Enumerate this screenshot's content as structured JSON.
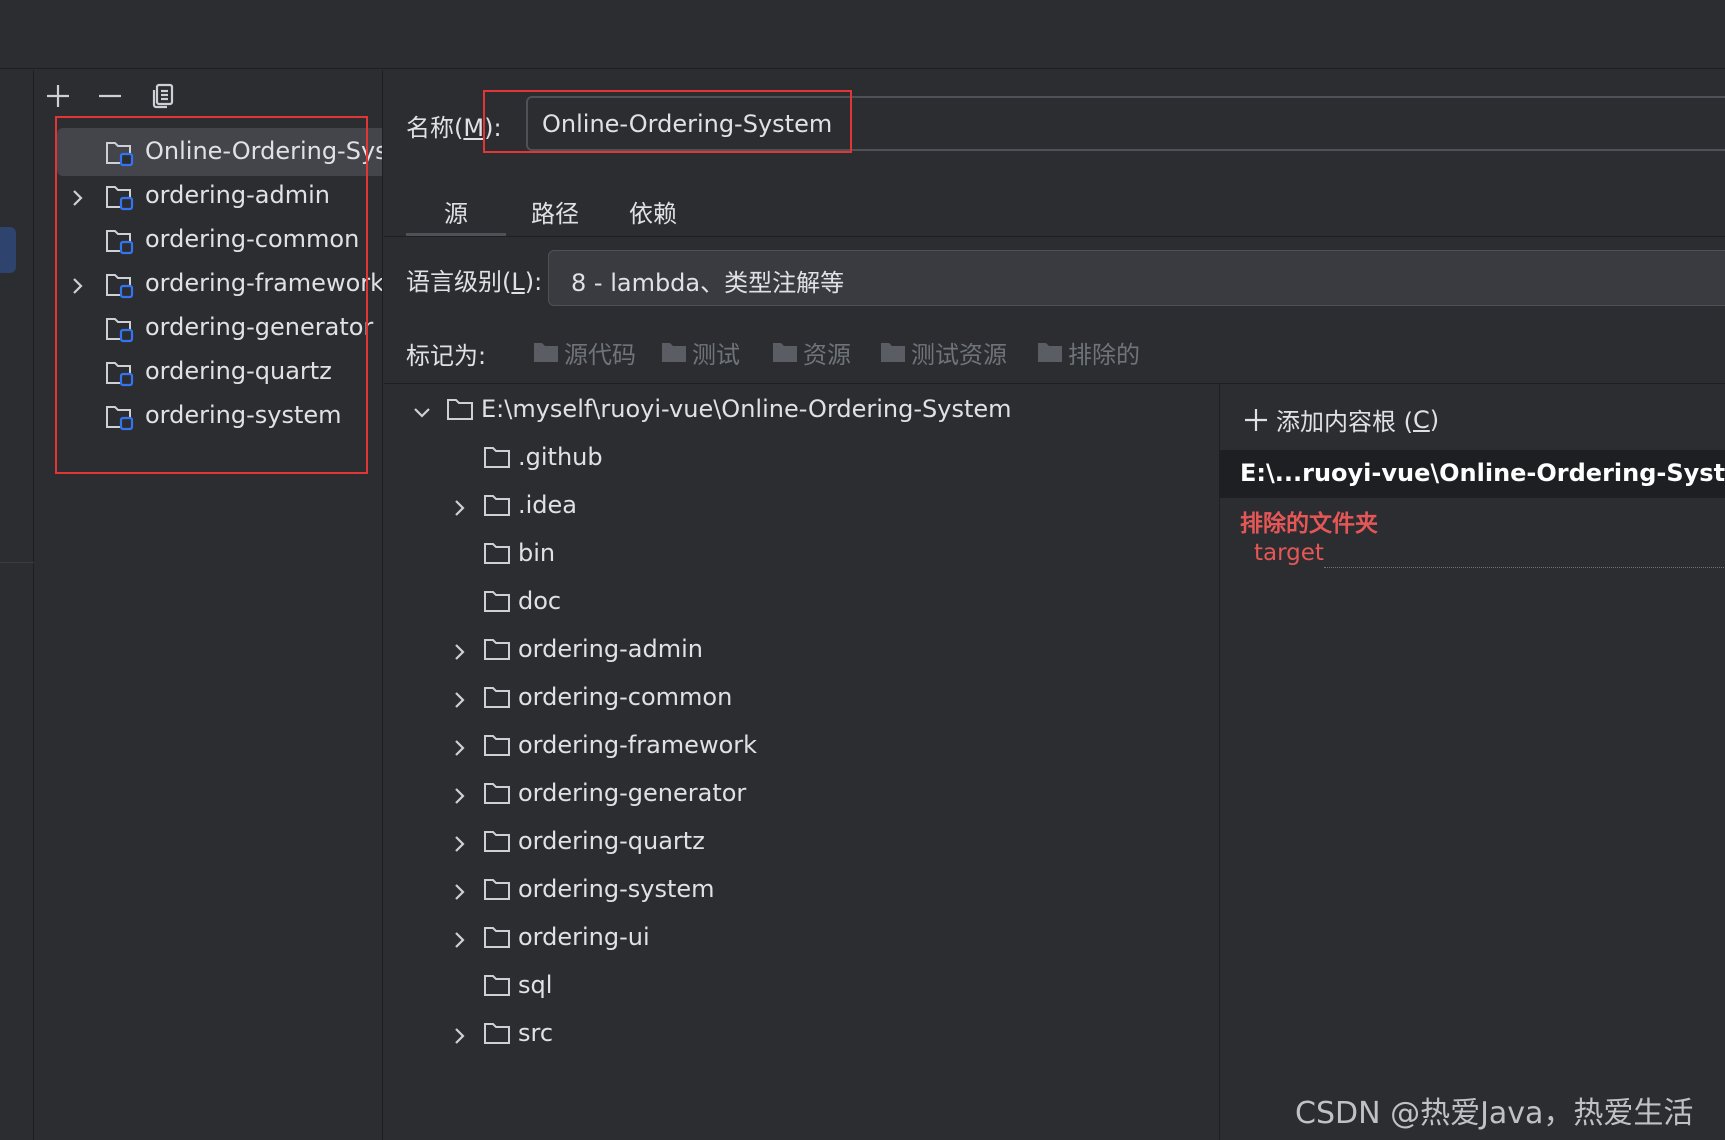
{
  "toolbar": {
    "add_icon": "plus-icon",
    "remove_icon": "minus-icon",
    "copy_icon": "copy-icon"
  },
  "modules": [
    {
      "label": "Online-Ordering-System",
      "expandable": false,
      "selected": true
    },
    {
      "label": "ordering-admin",
      "expandable": true,
      "selected": false
    },
    {
      "label": "ordering-common",
      "expandable": false,
      "selected": false
    },
    {
      "label": "ordering-framework",
      "expandable": true,
      "selected": false
    },
    {
      "label": "ordering-generator",
      "expandable": false,
      "selected": false
    },
    {
      "label": "ordering-quartz",
      "expandable": false,
      "selected": false
    },
    {
      "label": "ordering-system",
      "expandable": false,
      "selected": false
    }
  ],
  "name_field": {
    "label_prefix": "名称(",
    "mnemonic": "M",
    "label_suffix": "):",
    "value": "Online-Ordering-System"
  },
  "tabs": [
    "源",
    "路径",
    "依赖"
  ],
  "active_tab": "源",
  "language_level": {
    "label_prefix": "语言级别(",
    "mnemonic": "L",
    "label_suffix": "):",
    "value": "8 - lambda、类型注解等"
  },
  "mark_as": {
    "label": "标记为:",
    "options": [
      "源代码",
      "测试",
      "资源",
      "测试资源",
      "排除的"
    ]
  },
  "file_tree": {
    "root": "E:\\myself\\ruoyi-vue\\Online-Ordering-System",
    "children": [
      {
        "label": ".github",
        "expandable": false
      },
      {
        "label": ".idea",
        "expandable": true
      },
      {
        "label": "bin",
        "expandable": false
      },
      {
        "label": "doc",
        "expandable": false
      },
      {
        "label": "ordering-admin",
        "expandable": true
      },
      {
        "label": "ordering-common",
        "expandable": true
      },
      {
        "label": "ordering-framework",
        "expandable": true
      },
      {
        "label": "ordering-generator",
        "expandable": true
      },
      {
        "label": "ordering-quartz",
        "expandable": true
      },
      {
        "label": "ordering-system",
        "expandable": true
      },
      {
        "label": "ordering-ui",
        "expandable": true
      },
      {
        "label": "sql",
        "expandable": false
      },
      {
        "label": "src",
        "expandable": true
      }
    ]
  },
  "content_roots": {
    "add_label_prefix": "添加内容根 (",
    "add_mnemonic": "C",
    "add_label_suffix": ")",
    "root_path": "E:\\...ruoyi-vue\\Online-Ordering-System",
    "excluded_title": "排除的文件夹",
    "excluded": [
      "target"
    ]
  },
  "watermark": "CSDN @热爱Java，热爱生活",
  "colors": {
    "background": "#2b2d30",
    "highlight_box": "#e03636",
    "excluded_text": "#e55757",
    "module_icon_accent": "#3574f0"
  }
}
